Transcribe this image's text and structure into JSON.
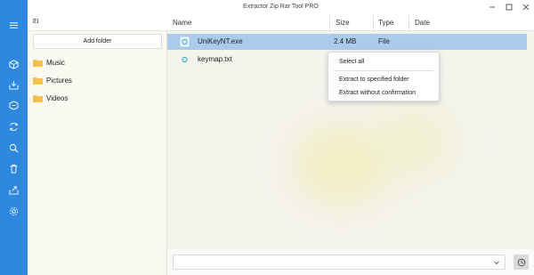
{
  "window": {
    "title": "Extractor Zip Rar Tool PRO"
  },
  "rail": {
    "icons": [
      "menu-icon",
      "box-icon",
      "archive-in-icon",
      "archive-out-icon",
      "refresh-icon",
      "search-icon",
      "trash-icon",
      "share-icon",
      "settings-icon"
    ]
  },
  "folder_pane": {
    "header": "EI",
    "add_folder_label": "Add folder",
    "items": [
      {
        "label": "Music"
      },
      {
        "label": "Pictures"
      },
      {
        "label": "Videos"
      }
    ]
  },
  "file_pane": {
    "columns": [
      "Name",
      "Size",
      "Type",
      "Date"
    ],
    "rows": [
      {
        "name": "UniKeyNT.exe",
        "size": "2.4 MB",
        "type": "File",
        "date": "",
        "selected": true
      },
      {
        "name": "keymap.txt",
        "size": "",
        "type": "",
        "date": "",
        "selected": false
      }
    ]
  },
  "context_menu": {
    "items": [
      "Select all",
      "Extract to specified folder",
      "Extract without confirmation"
    ]
  },
  "bottom": {
    "path_value": ""
  },
  "colors": {
    "rail": "#2e88e0",
    "selection": "#aacbeb",
    "folder": "#f2c24b"
  }
}
